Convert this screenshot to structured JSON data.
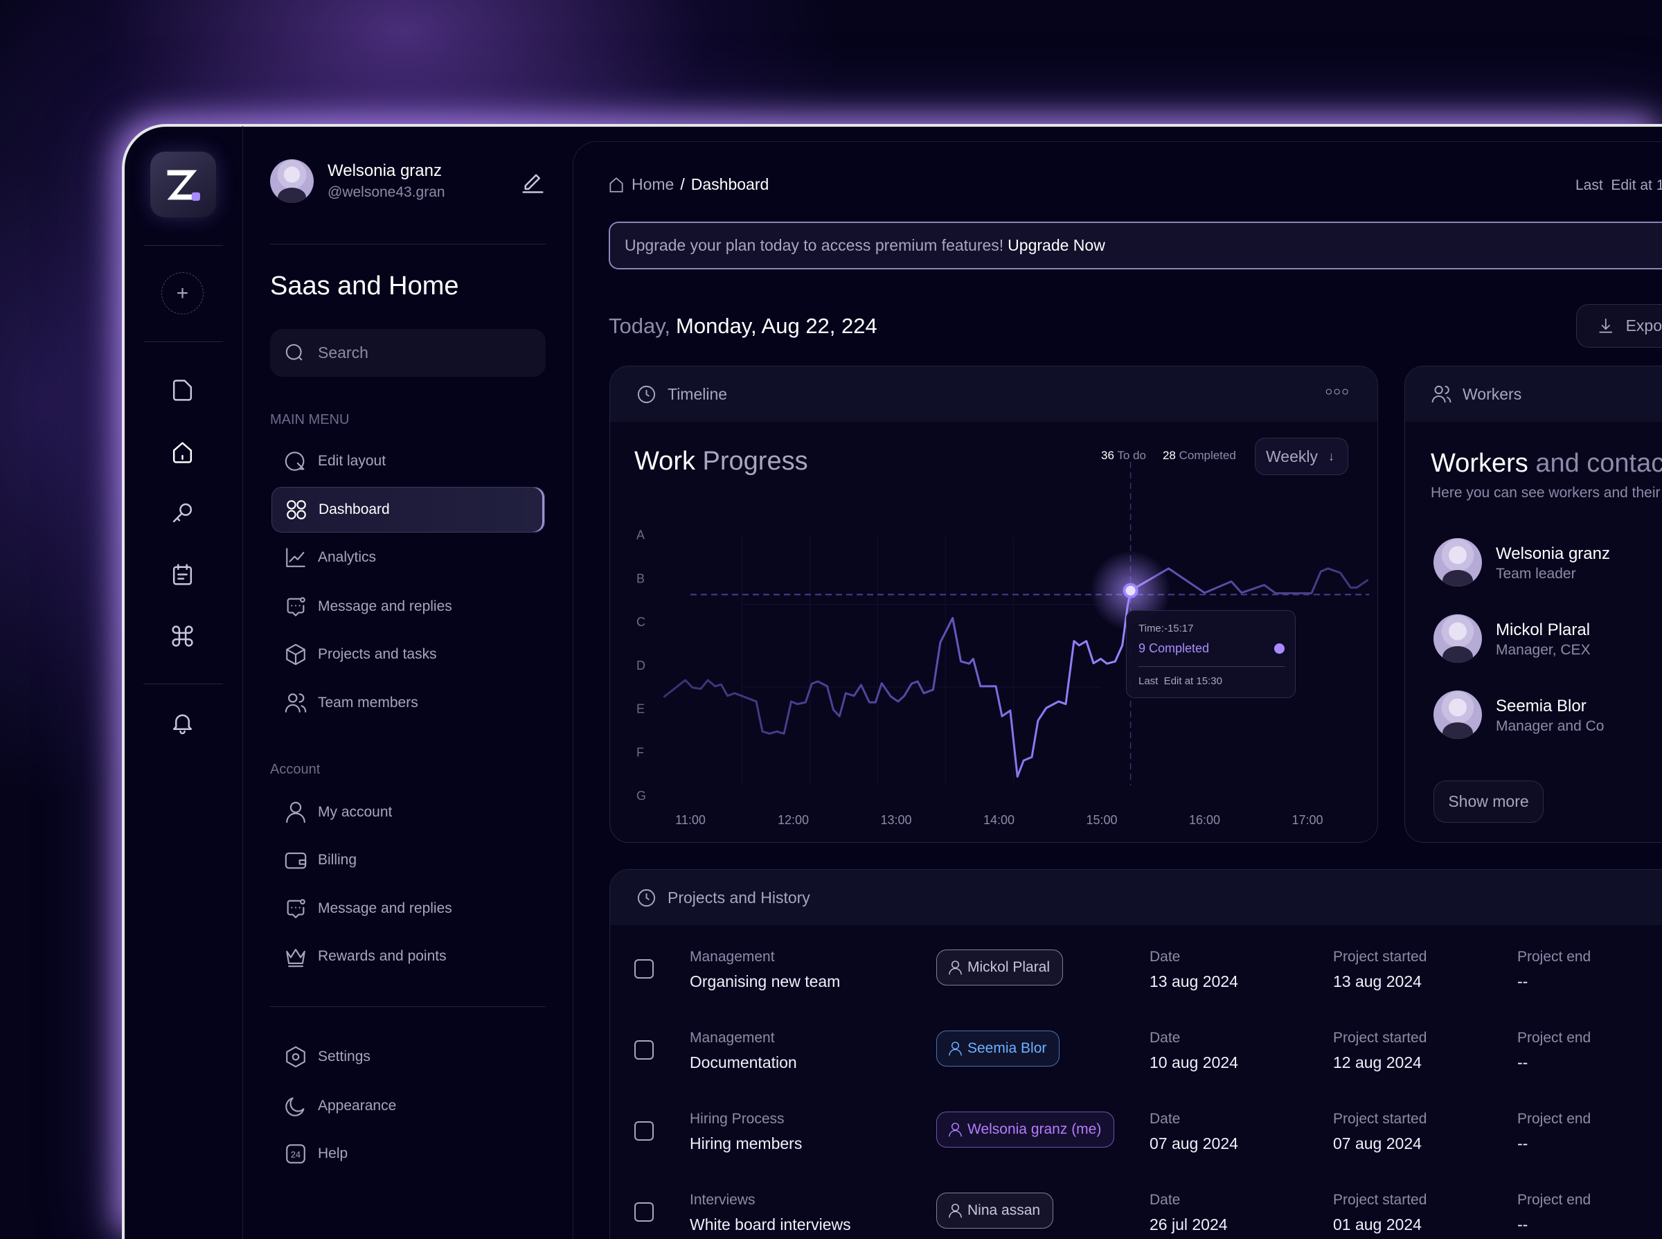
{
  "user": {
    "name": "Welsonia granz",
    "handle": "@welsone43.gran"
  },
  "workspace_title": "Saas and Home",
  "search": {
    "placeholder": "Search"
  },
  "main_menu": {
    "label": "MAIN MENU",
    "items": [
      {
        "label": "Edit layout"
      },
      {
        "label": "Dashboard",
        "active": true
      },
      {
        "label": "Analytics"
      },
      {
        "label": "Message and replies"
      },
      {
        "label": "Projects and tasks"
      },
      {
        "label": "Team members"
      }
    ]
  },
  "account_menu": {
    "label": "Account",
    "items": [
      {
        "label": "My account"
      },
      {
        "label": "Billing"
      },
      {
        "label": "Message and replies"
      },
      {
        "label": "Rewards and points"
      }
    ]
  },
  "bottom_menu": {
    "items": [
      {
        "label": "Settings"
      },
      {
        "label": "Appearance"
      },
      {
        "label": "Help"
      }
    ]
  },
  "breadcrumb": {
    "home": "Home",
    "sep": "/",
    "current": "Dashboard"
  },
  "last_edit": "Last  Edit at 1",
  "banner": {
    "text": "Upgrade your plan today to access premium features!",
    "cta": "Upgrade Now"
  },
  "date": {
    "prefix": "Today,",
    "value": "Monday, Aug 22, 224"
  },
  "export_label": "Expo",
  "timeline": {
    "header": "Timeline",
    "title_a": "Work",
    "title_b": "Progress",
    "todo_count": "36",
    "todo_label": "To do",
    "completed_count": "28",
    "completed_label": "Completed",
    "period": "Weekly",
    "tooltip": {
      "time": "Time:-15:17",
      "completed": "9 Completed",
      "last_edit": "Last  Edit at 15:30"
    }
  },
  "chart_data": {
    "type": "line",
    "title": "Work Progress",
    "xlabel": "",
    "ylabel": "",
    "x_ticks": [
      "11:00",
      "12:00",
      "13:00",
      "14:00",
      "15:00",
      "16:00",
      "17:00"
    ],
    "y_ticks": [
      "A",
      "B",
      "C",
      "D",
      "E",
      "F",
      "G"
    ],
    "y_scale_note": "G=0 ... A=6",
    "xlim": [
      10.7,
      17.6
    ],
    "ylim": [
      0,
      6
    ],
    "highlight": {
      "x": 15.28,
      "y": 4.72
    },
    "reference_y": 4.63,
    "points": [
      [
        10.74,
        2.27
      ],
      [
        10.95,
        2.66
      ],
      [
        11.02,
        2.49
      ],
      [
        11.1,
        2.46
      ],
      [
        11.17,
        2.66
      ],
      [
        11.24,
        2.52
      ],
      [
        11.3,
        2.56
      ],
      [
        11.36,
        2.3
      ],
      [
        11.43,
        2.36
      ],
      [
        11.64,
        2.17
      ],
      [
        11.7,
        1.48
      ],
      [
        11.77,
        1.43
      ],
      [
        11.84,
        1.48
      ],
      [
        11.91,
        1.43
      ],
      [
        11.98,
        2.17
      ],
      [
        12.04,
        2.11
      ],
      [
        12.12,
        2.15
      ],
      [
        12.18,
        2.58
      ],
      [
        12.24,
        2.63
      ],
      [
        12.33,
        2.52
      ],
      [
        12.39,
        1.98
      ],
      [
        12.45,
        1.83
      ],
      [
        12.51,
        2.36
      ],
      [
        12.59,
        2.3
      ],
      [
        12.66,
        2.55
      ],
      [
        12.74,
        2.15
      ],
      [
        12.8,
        2.15
      ],
      [
        12.86,
        2.59
      ],
      [
        12.95,
        2.28
      ],
      [
        13.02,
        2.17
      ],
      [
        13.08,
        2.3
      ],
      [
        13.15,
        2.58
      ],
      [
        13.21,
        2.63
      ],
      [
        13.27,
        2.36
      ],
      [
        13.36,
        2.44
      ],
      [
        13.43,
        3.53
      ],
      [
        13.55,
        4.09
      ],
      [
        13.63,
        3.09
      ],
      [
        13.71,
        3.04
      ],
      [
        13.75,
        3.15
      ],
      [
        13.82,
        2.52
      ],
      [
        13.97,
        2.52
      ],
      [
        14.03,
        1.83
      ],
      [
        14.11,
        1.96
      ],
      [
        14.18,
        0.44
      ],
      [
        14.24,
        0.81
      ],
      [
        14.32,
        0.89
      ],
      [
        14.38,
        1.73
      ],
      [
        14.46,
        2.02
      ],
      [
        14.58,
        2.17
      ],
      [
        14.65,
        2.11
      ],
      [
        14.73,
        3.56
      ],
      [
        14.78,
        3.46
      ],
      [
        14.85,
        3.56
      ],
      [
        14.92,
        3.05
      ],
      [
        14.99,
        3.15
      ],
      [
        15.05,
        3.04
      ],
      [
        15.13,
        3.09
      ],
      [
        15.2,
        3.46
      ],
      [
        15.25,
        4.35
      ],
      [
        15.28,
        4.72
      ],
      [
        15.65,
        5.23
      ],
      [
        16.0,
        4.67
      ],
      [
        16.26,
        4.93
      ],
      [
        16.36,
        4.67
      ],
      [
        16.58,
        4.85
      ],
      [
        16.69,
        4.66
      ],
      [
        17.04,
        4.66
      ],
      [
        17.13,
        5.16
      ],
      [
        17.2,
        5.23
      ],
      [
        17.32,
        5.13
      ],
      [
        17.42,
        4.79
      ],
      [
        17.48,
        4.79
      ],
      [
        17.59,
        4.97
      ]
    ]
  },
  "workers": {
    "header": "Workers",
    "title_a": "Workers",
    "title_b": "and contact",
    "subtitle": "Here you can see workers and their",
    "list": [
      {
        "name": "Welsonia granz",
        "role": "Team leader"
      },
      {
        "name": "Mickol Plaral",
        "role": "Manager, CEX"
      },
      {
        "name": "Seemia Blor",
        "role": "Manager and Co"
      }
    ],
    "show_more": "Show more"
  },
  "projects": {
    "header": "Projects and History",
    "date_label": "Date",
    "started_label": "Project started",
    "end_label": "Project end",
    "rows": [
      {
        "category": "Management",
        "title": "Organising new team",
        "assignee": "Mickol Plaral",
        "color": "#c9c5de",
        "date": "13 aug 2024",
        "started": "13 aug 2024",
        "end": "--"
      },
      {
        "category": "Management",
        "title": "Documentation",
        "assignee": "Seemia Blor",
        "color": "#6fb0ff",
        "date": "10 aug 2024",
        "started": "12 aug 2024",
        "end": "--"
      },
      {
        "category": "Hiring Process",
        "title": "Hiring members",
        "assignee": "Welsonia granz (me)",
        "color": "#b57cff",
        "date": "07 aug 2024",
        "started": "07 aug 2024",
        "end": "--"
      },
      {
        "category": "Interviews",
        "title": "White board interviews",
        "assignee": "Nina assan",
        "color": "#c9c5de",
        "date": "26 jul 2024",
        "started": "01 aug 2024",
        "end": "--"
      }
    ]
  }
}
